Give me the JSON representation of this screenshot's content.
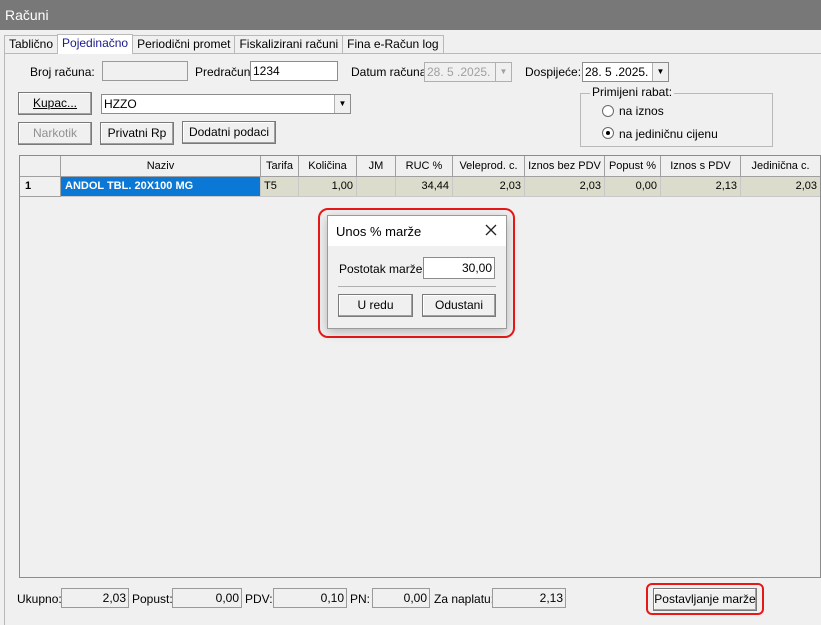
{
  "window": {
    "title": "Računi"
  },
  "tabs": [
    "Tablično",
    "Pojedinačno",
    "Periodični promet",
    "Fiskalizirani računi",
    "Fina e-Račun log"
  ],
  "form": {
    "broj_racuna_label": "Broj računa:",
    "broj_racuna_value": "",
    "predracun_label": "Predračun:",
    "predracun_value": "1234",
    "datum_racuna_label": "Datum računa:",
    "datum_racuna_value": "28. 5 .2025.",
    "dospijece_label": "Dospijeće:",
    "dospijece_value": "28. 5 .2025.",
    "kupac_button": "Kupac...",
    "kupac_value": "HZZO",
    "narkotik_button": "Narkotik",
    "privatni_rp_button": "Privatni Rp",
    "dodatni_podaci_button": "Dodatni podaci"
  },
  "rabat": {
    "title": "Primijeni rabat:",
    "option_iznos": "na iznos",
    "option_jedinicna": "na jediničnu cijenu",
    "selected": "na jediničnu cijenu"
  },
  "grid": {
    "columns": [
      "Naziv",
      "Tarifa",
      "Količina",
      "JM",
      "RUC %",
      "Veleprod. c.",
      "Iznos bez PDV",
      "Popust %",
      "Iznos s PDV",
      "Jedinična c."
    ],
    "rows": [
      {
        "num": "1",
        "naziv": "ANDOL TBL. 20X100 MG",
        "tarifa": "T5",
        "kolicina": "1,00",
        "jm": "",
        "ruc": "34,44",
        "veleprod": "2,03",
        "iznos_bez_pdv": "2,03",
        "popust": "0,00",
        "iznos_s_pdv": "2,13",
        "jedinicna": "2,03"
      }
    ]
  },
  "dialog": {
    "title": "Unos % marže",
    "field_label": "Postotak marže:",
    "field_value": "30,00",
    "ok_button": "U redu",
    "cancel_button": "Odustani"
  },
  "totals": {
    "ukupno_label": "Ukupno:",
    "ukupno_value": "2,03",
    "popust_label": "Popust:",
    "popust_value": "0,00",
    "pdv_label": "PDV:",
    "pdv_value": "0,10",
    "pn_label": "PN:",
    "pn_value": "0,00",
    "za_naplatu_label": "Za naplatu:",
    "za_naplatu_value": "2,13",
    "postavljanje_button": "Postavljanje marže"
  },
  "colors": {
    "selection": "#0a78d4",
    "highlight_ring": "#e81818",
    "titlebar": "#787878"
  }
}
